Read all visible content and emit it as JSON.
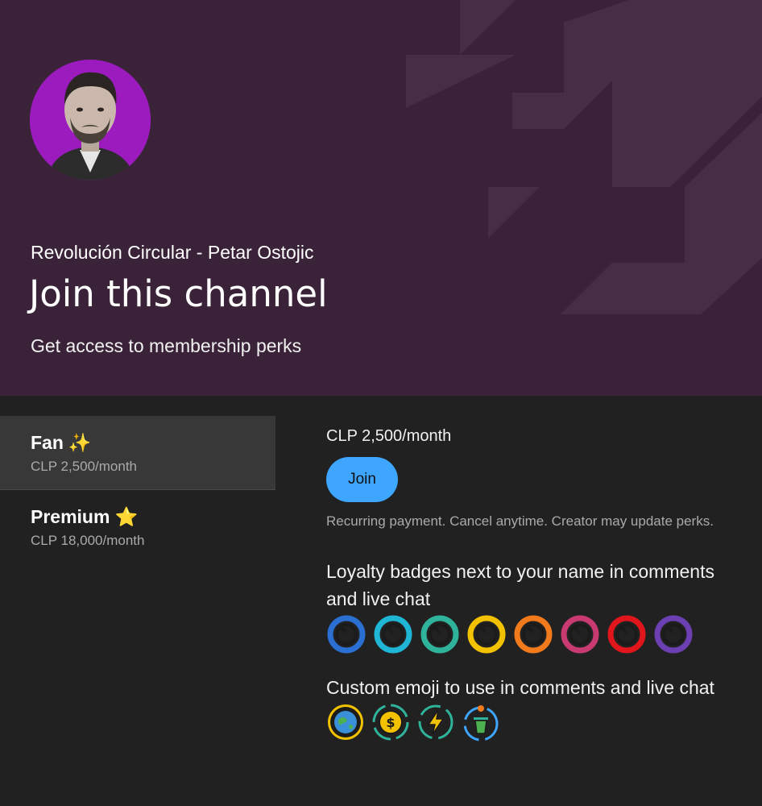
{
  "header": {
    "channel_name": "Revolución Circular - Petar Ostojic",
    "title": "Join this channel",
    "subtitle": "Get access to membership perks",
    "background_color": "#3a2338",
    "avatar_icon": "channel-avatar-portrait"
  },
  "tiers": [
    {
      "name": "Fan",
      "emoji": "✨",
      "price": "CLP 2,500/month",
      "selected": true
    },
    {
      "name": "Premium",
      "emoji": "⭐",
      "price": "CLP 18,000/month",
      "selected": false
    }
  ],
  "detail": {
    "price": "CLP 2,500/month",
    "join_label": "Join",
    "recurring_note": "Recurring payment. Cancel anytime. Creator may update perks.",
    "perks": [
      {
        "title": "Loyalty badges next to your name in comments and live chat",
        "badge_colors": [
          "#2a6fd1",
          "#1fb6d6",
          "#2fb39a",
          "#f2c200",
          "#f07a1c",
          "#c93a72",
          "#e0161c",
          "#6c3fb3"
        ]
      },
      {
        "title": "Custom emoji to use in comments and live chat",
        "emoji_icons": [
          "earth-recycle-icon",
          "coin-recycle-icon",
          "energy-recycle-icon",
          "bin-recycle-icon"
        ]
      }
    ]
  }
}
